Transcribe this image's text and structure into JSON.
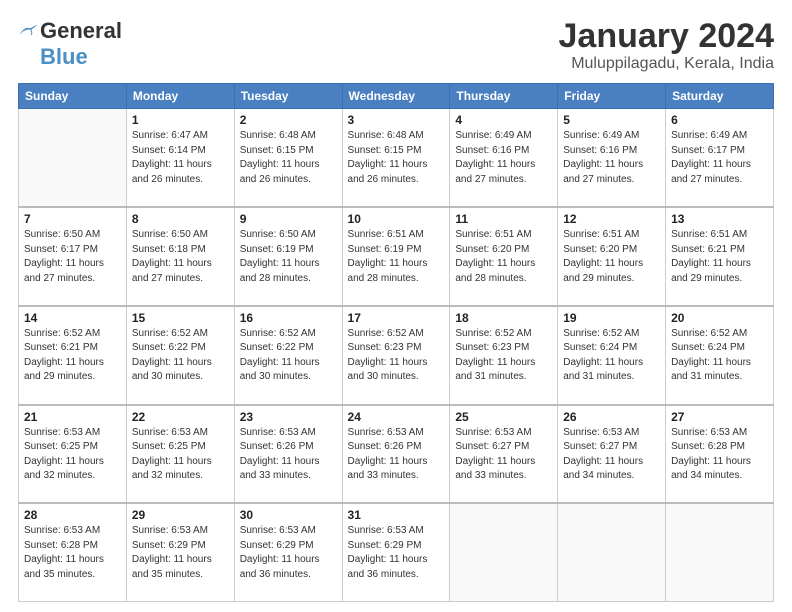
{
  "header": {
    "logo_line1": "General",
    "logo_line2": "Blue",
    "title": "January 2024",
    "subtitle": "Muluppilagadu, Kerala, India"
  },
  "days_of_week": [
    "Sunday",
    "Monday",
    "Tuesday",
    "Wednesday",
    "Thursday",
    "Friday",
    "Saturday"
  ],
  "weeks": [
    [
      {
        "num": "",
        "info": ""
      },
      {
        "num": "1",
        "info": "Sunrise: 6:47 AM\nSunset: 6:14 PM\nDaylight: 11 hours\nand 26 minutes."
      },
      {
        "num": "2",
        "info": "Sunrise: 6:48 AM\nSunset: 6:15 PM\nDaylight: 11 hours\nand 26 minutes."
      },
      {
        "num": "3",
        "info": "Sunrise: 6:48 AM\nSunset: 6:15 PM\nDaylight: 11 hours\nand 26 minutes."
      },
      {
        "num": "4",
        "info": "Sunrise: 6:49 AM\nSunset: 6:16 PM\nDaylight: 11 hours\nand 27 minutes."
      },
      {
        "num": "5",
        "info": "Sunrise: 6:49 AM\nSunset: 6:16 PM\nDaylight: 11 hours\nand 27 minutes."
      },
      {
        "num": "6",
        "info": "Sunrise: 6:49 AM\nSunset: 6:17 PM\nDaylight: 11 hours\nand 27 minutes."
      }
    ],
    [
      {
        "num": "7",
        "info": "Sunrise: 6:50 AM\nSunset: 6:17 PM\nDaylight: 11 hours\nand 27 minutes."
      },
      {
        "num": "8",
        "info": "Sunrise: 6:50 AM\nSunset: 6:18 PM\nDaylight: 11 hours\nand 27 minutes."
      },
      {
        "num": "9",
        "info": "Sunrise: 6:50 AM\nSunset: 6:19 PM\nDaylight: 11 hours\nand 28 minutes."
      },
      {
        "num": "10",
        "info": "Sunrise: 6:51 AM\nSunset: 6:19 PM\nDaylight: 11 hours\nand 28 minutes."
      },
      {
        "num": "11",
        "info": "Sunrise: 6:51 AM\nSunset: 6:20 PM\nDaylight: 11 hours\nand 28 minutes."
      },
      {
        "num": "12",
        "info": "Sunrise: 6:51 AM\nSunset: 6:20 PM\nDaylight: 11 hours\nand 29 minutes."
      },
      {
        "num": "13",
        "info": "Sunrise: 6:51 AM\nSunset: 6:21 PM\nDaylight: 11 hours\nand 29 minutes."
      }
    ],
    [
      {
        "num": "14",
        "info": "Sunrise: 6:52 AM\nSunset: 6:21 PM\nDaylight: 11 hours\nand 29 minutes."
      },
      {
        "num": "15",
        "info": "Sunrise: 6:52 AM\nSunset: 6:22 PM\nDaylight: 11 hours\nand 30 minutes."
      },
      {
        "num": "16",
        "info": "Sunrise: 6:52 AM\nSunset: 6:22 PM\nDaylight: 11 hours\nand 30 minutes."
      },
      {
        "num": "17",
        "info": "Sunrise: 6:52 AM\nSunset: 6:23 PM\nDaylight: 11 hours\nand 30 minutes."
      },
      {
        "num": "18",
        "info": "Sunrise: 6:52 AM\nSunset: 6:23 PM\nDaylight: 11 hours\nand 31 minutes."
      },
      {
        "num": "19",
        "info": "Sunrise: 6:52 AM\nSunset: 6:24 PM\nDaylight: 11 hours\nand 31 minutes."
      },
      {
        "num": "20",
        "info": "Sunrise: 6:52 AM\nSunset: 6:24 PM\nDaylight: 11 hours\nand 31 minutes."
      }
    ],
    [
      {
        "num": "21",
        "info": "Sunrise: 6:53 AM\nSunset: 6:25 PM\nDaylight: 11 hours\nand 32 minutes."
      },
      {
        "num": "22",
        "info": "Sunrise: 6:53 AM\nSunset: 6:25 PM\nDaylight: 11 hours\nand 32 minutes."
      },
      {
        "num": "23",
        "info": "Sunrise: 6:53 AM\nSunset: 6:26 PM\nDaylight: 11 hours\nand 33 minutes."
      },
      {
        "num": "24",
        "info": "Sunrise: 6:53 AM\nSunset: 6:26 PM\nDaylight: 11 hours\nand 33 minutes."
      },
      {
        "num": "25",
        "info": "Sunrise: 6:53 AM\nSunset: 6:27 PM\nDaylight: 11 hours\nand 33 minutes."
      },
      {
        "num": "26",
        "info": "Sunrise: 6:53 AM\nSunset: 6:27 PM\nDaylight: 11 hours\nand 34 minutes."
      },
      {
        "num": "27",
        "info": "Sunrise: 6:53 AM\nSunset: 6:28 PM\nDaylight: 11 hours\nand 34 minutes."
      }
    ],
    [
      {
        "num": "28",
        "info": "Sunrise: 6:53 AM\nSunset: 6:28 PM\nDaylight: 11 hours\nand 35 minutes."
      },
      {
        "num": "29",
        "info": "Sunrise: 6:53 AM\nSunset: 6:29 PM\nDaylight: 11 hours\nand 35 minutes."
      },
      {
        "num": "30",
        "info": "Sunrise: 6:53 AM\nSunset: 6:29 PM\nDaylight: 11 hours\nand 36 minutes."
      },
      {
        "num": "31",
        "info": "Sunrise: 6:53 AM\nSunset: 6:29 PM\nDaylight: 11 hours\nand 36 minutes."
      },
      {
        "num": "",
        "info": ""
      },
      {
        "num": "",
        "info": ""
      },
      {
        "num": "",
        "info": ""
      }
    ]
  ]
}
